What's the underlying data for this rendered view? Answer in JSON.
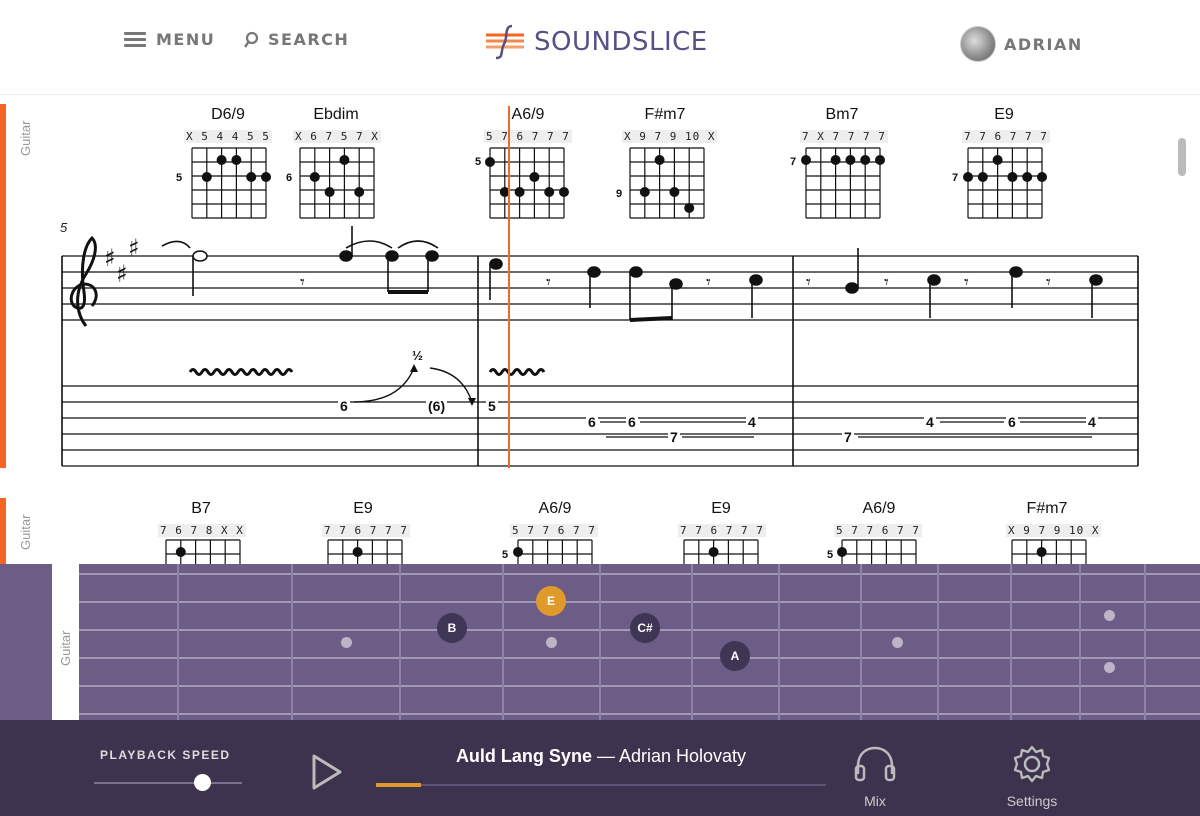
{
  "header": {
    "menu_label": "MENU",
    "search_label": "SEARCH",
    "logo_text": "SOUNDSLICE",
    "user_name": "ADRIAN"
  },
  "score": {
    "system1": {
      "track_label": "Guitar",
      "measure_number": "5",
      "chords": [
        {
          "name": "D6/9",
          "fingering": "X 5 4 4 5 5",
          "fret": "5"
        },
        {
          "name": "Ebdim",
          "fingering": "X 6 7 5 7 X",
          "fret": "6"
        },
        {
          "name": "A6/9",
          "fingering": "5 7 6 7 7 7",
          "fret": "5"
        },
        {
          "name": "F#m7",
          "fingering": "X 9 7 9 10 X",
          "fret": "9"
        },
        {
          "name": "Bm7",
          "fingering": "7 X 7 7 7 7",
          "fret": "7"
        },
        {
          "name": "E9",
          "fingering": "7 7 6 7 7 7",
          "fret": "7"
        }
      ],
      "bend_amount": "½",
      "tab_numbers": [
        "6",
        "(6)",
        "5",
        "6",
        "6",
        "7",
        "4",
        "7",
        "4",
        "6",
        "4"
      ]
    },
    "system2": {
      "track_label": "Guitar",
      "chords": [
        {
          "name": "B7",
          "fingering": "7 6 7 8 X X",
          "fret": ""
        },
        {
          "name": "E9",
          "fingering": "7 7 6 7 7 7",
          "fret": ""
        },
        {
          "name": "A6/9",
          "fingering": "5 7 7 6 7 7",
          "fret": "5"
        },
        {
          "name": "E9",
          "fingering": "7 7 6 7 7 7",
          "fret": ""
        },
        {
          "name": "A6/9",
          "fingering": "5 7 7 6 7 7",
          "fret": "5"
        },
        {
          "name": "F#m7",
          "fingering": "X 9 7 9 10 X",
          "fret": ""
        }
      ]
    }
  },
  "fretboard": {
    "track_label": "Guitar",
    "notes": [
      {
        "label": "E",
        "state": "active"
      },
      {
        "label": "B",
        "state": "dark"
      },
      {
        "label": "C#",
        "state": "dark"
      },
      {
        "label": "A",
        "state": "dark"
      }
    ]
  },
  "footer": {
    "playback_speed_label": "PLAYBACK SPEED",
    "playback_speed_fraction": 0.73,
    "song_title": "Auld Lang Syne",
    "song_separator": " — ",
    "song_artist": "Adrian Holovaty",
    "progress_fraction": 0.1,
    "mix_label": "Mix",
    "settings_label": "Settings"
  },
  "colors": {
    "accent_orange": "#f26522",
    "playhead": "#ee6a2a",
    "brand_purple": "#5a4e86",
    "fretboard": "#6c5d86",
    "footer": "#3d334f",
    "active_note": "#e09a2b"
  }
}
